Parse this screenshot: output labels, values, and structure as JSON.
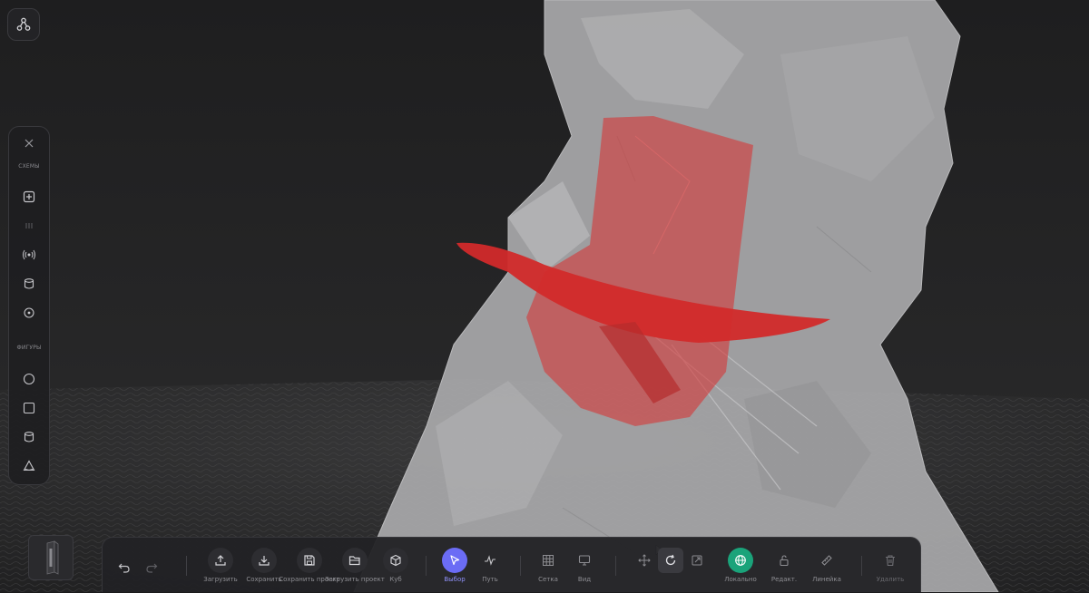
{
  "sidebar": {
    "section_schemes": "СХЕМЫ",
    "section_shapes": "ФИГУРЫ"
  },
  "toolbar": {
    "upload": "Загрузить",
    "save": "Сохранить",
    "save_project": "Сохранить проект",
    "load_project": "Загрузить проект",
    "cube": "Куб",
    "select": "Выбор",
    "path": "Путь",
    "grid": "Сетка",
    "view": "Вид",
    "local": "Локально",
    "edit": "Редакт.",
    "ruler": "Линейка",
    "delete": "Удалить"
  },
  "colors": {
    "accent_select": "#6b6cf5",
    "accent_local": "#1aa37a",
    "model_red": "#d33a3a"
  }
}
